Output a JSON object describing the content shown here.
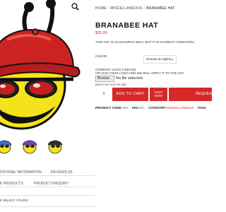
{
  "breadcrumb": {
    "home": "HOME",
    "category": "MISCELLANEOUS",
    "current": "BRANABEE HAT"
  },
  "product": {
    "title": "BRANABEE HAT",
    "price": "$25.00",
    "description": "THIS HAT IS AN EXAMPLE ONLY, BUT IT IS IN GREAT CONDITION!"
  },
  "options": {
    "color_label": "COLOR",
    "color_select": "Choose an option",
    "logo_label": "COMPANY LOGO (+$10.00)",
    "logo_instruction": "UPLOAD YOUR LOGO AND WE WILL APPLY IT TO THE HAT.",
    "browse_label": "Browse...",
    "file_status": "No file selected.",
    "max_size": "(MAX FILE SIZE 50 MB)"
  },
  "cart": {
    "quantity": "1",
    "add_to_cart": "ADD TO CART",
    "chat_now_line1": "CHAT",
    "chat_now_line2": "NOW",
    "request": "REQUEST"
  },
  "meta": {
    "code_key": "PRODUCT CODE:",
    "code_val": "N/A",
    "sku_key": "SKU",
    "sku_val": "N/A",
    "category_key": "CATEGORY",
    "category_val": "MISCELLANEOUS",
    "tags_key": "TAGS"
  },
  "tabs": {
    "additional_information": "DITIONAL INFORMATION",
    "reviews": "REVIEWS (0)",
    "more_products": "E PRODUCTS",
    "product_enquiry": "PRODUCT ENQUIRY"
  },
  "review_prompt": "E SELECT YOURS!",
  "colors": {
    "accent": "#d62828",
    "price": "#d62b2b"
  },
  "icons": {
    "zoom": "magnifier-icon"
  }
}
